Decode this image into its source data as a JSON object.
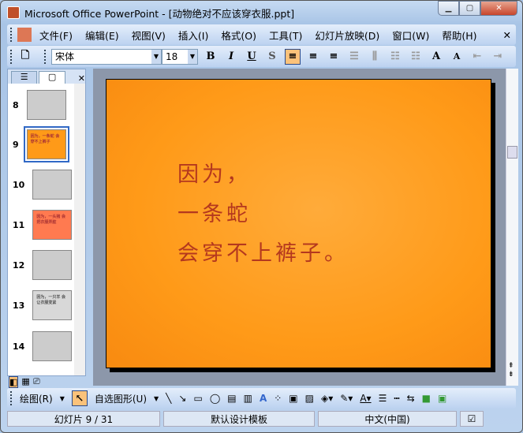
{
  "window": {
    "title": "Microsoft Office PowerPoint - [动物绝对不应该穿衣服.ppt]"
  },
  "menu": [
    "文件(F)",
    "编辑(E)",
    "视图(V)",
    "插入(I)",
    "格式(O)",
    "工具(T)",
    "幻灯片放映(D)",
    "窗口(W)",
    "帮助(H)"
  ],
  "format": {
    "font": "宋体",
    "size": "18"
  },
  "thumbnails": [
    {
      "n": "8"
    },
    {
      "n": "9",
      "text": "因为，一条蛇 会穿不上裤子"
    },
    {
      "n": "10"
    },
    {
      "n": "11",
      "text": "因为，一头猪 会把衣服弄脏"
    },
    {
      "n": "12"
    },
    {
      "n": "13",
      "text": "因为，一只羊 会让衣服变紧"
    },
    {
      "n": "14"
    }
  ],
  "slide": {
    "lines": [
      "因为，",
      "一条蛇",
      "会穿不上裤子。"
    ]
  },
  "drawing": {
    "draw_label": "绘图(R)",
    "autoshape_label": "自选图形(U)"
  },
  "status": {
    "slide": "幻灯片 9 / 31",
    "template": "默认设计模板",
    "language": "中文(中国)"
  },
  "colors": {
    "slide_bg": "#ff9a18",
    "slide_text": "#b4381e"
  }
}
